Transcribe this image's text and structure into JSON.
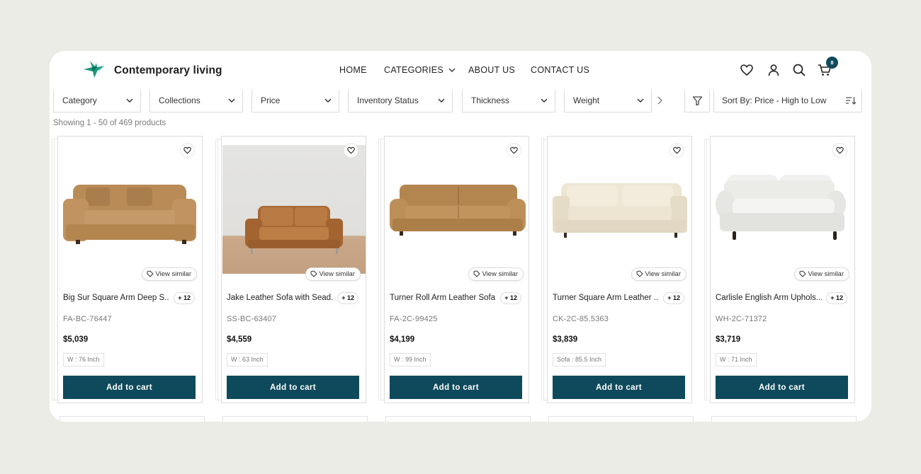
{
  "brand": {
    "name": "Contemporary living",
    "logo": "hummingbird-logo"
  },
  "nav": {
    "home": "HOME",
    "categories": "CATEGORIES",
    "about": "ABOUT US",
    "contact": "CONTACT US"
  },
  "header_icons": {
    "wishlist": "heart-icon",
    "account": "user-icon",
    "search": "search-icon",
    "cart": "cart-icon",
    "cart_count": "8"
  },
  "filters": {
    "category": "Category",
    "collections": "Collections",
    "price": "Price",
    "inventory": "Inventory Status",
    "thickness": "Thickness",
    "weight": "Weight"
  },
  "sort": {
    "label": "Sort By: Price - High to Low"
  },
  "results": {
    "summary": "Showing 1 - 50 of 469 products"
  },
  "common": {
    "view_similar": "View similar",
    "add_to_cart": "Add to cart"
  },
  "products": [
    {
      "name": "Big Sur Square Arm Deep S...",
      "variants": "+ 12",
      "sku": "FA-BC-76447",
      "price": "$5,039",
      "dimension": "W : 76 Inch"
    },
    {
      "name": "Jake Leather Sofa with Sead...",
      "variants": "+ 12",
      "sku": "SS-BC-63407",
      "price": "$4,559",
      "dimension": "W : 63 Inch"
    },
    {
      "name": "Turner Roll Arm Leather Sofa",
      "variants": "+ 12",
      "sku": "FA-2C-99425",
      "price": "$4,199",
      "dimension": "W : 99 Inch"
    },
    {
      "name": "Turner Square Arm Leather ...",
      "variants": "+ 12",
      "sku": "CK-2C-85.5363",
      "price": "$3,839",
      "dimension": "Sofa : 85.5 Inch"
    },
    {
      "name": "Carlisle English Arm Uphols...",
      "variants": "+ 12",
      "sku": "WH-2C-71372",
      "price": "$3,719",
      "dimension": "W : 71 Inch"
    }
  ],
  "colors": {
    "accent": "#0f4a5c",
    "background": "#ecece6",
    "logo_green": "#1a9a7a"
  }
}
